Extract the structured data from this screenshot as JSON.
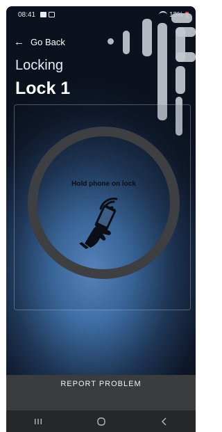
{
  "status_bar": {
    "time": "08:41",
    "battery": "13%"
  },
  "header": {
    "back_label": "Go Back",
    "subtitle": "Locking",
    "title": "Lock 1"
  },
  "lock_panel": {
    "instruction": "Hold phone on lock"
  },
  "footer": {
    "report_label": "REPORT PROBLEM"
  },
  "nav_bar": {
    "icons": [
      "recent-apps-icon",
      "home-icon",
      "back-icon"
    ]
  },
  "colors": {
    "accent_blue": "#4f7fbf",
    "ring": "#3e3f43",
    "footer_bg": "#3b3c3e",
    "battery_low": "#e0554f"
  }
}
